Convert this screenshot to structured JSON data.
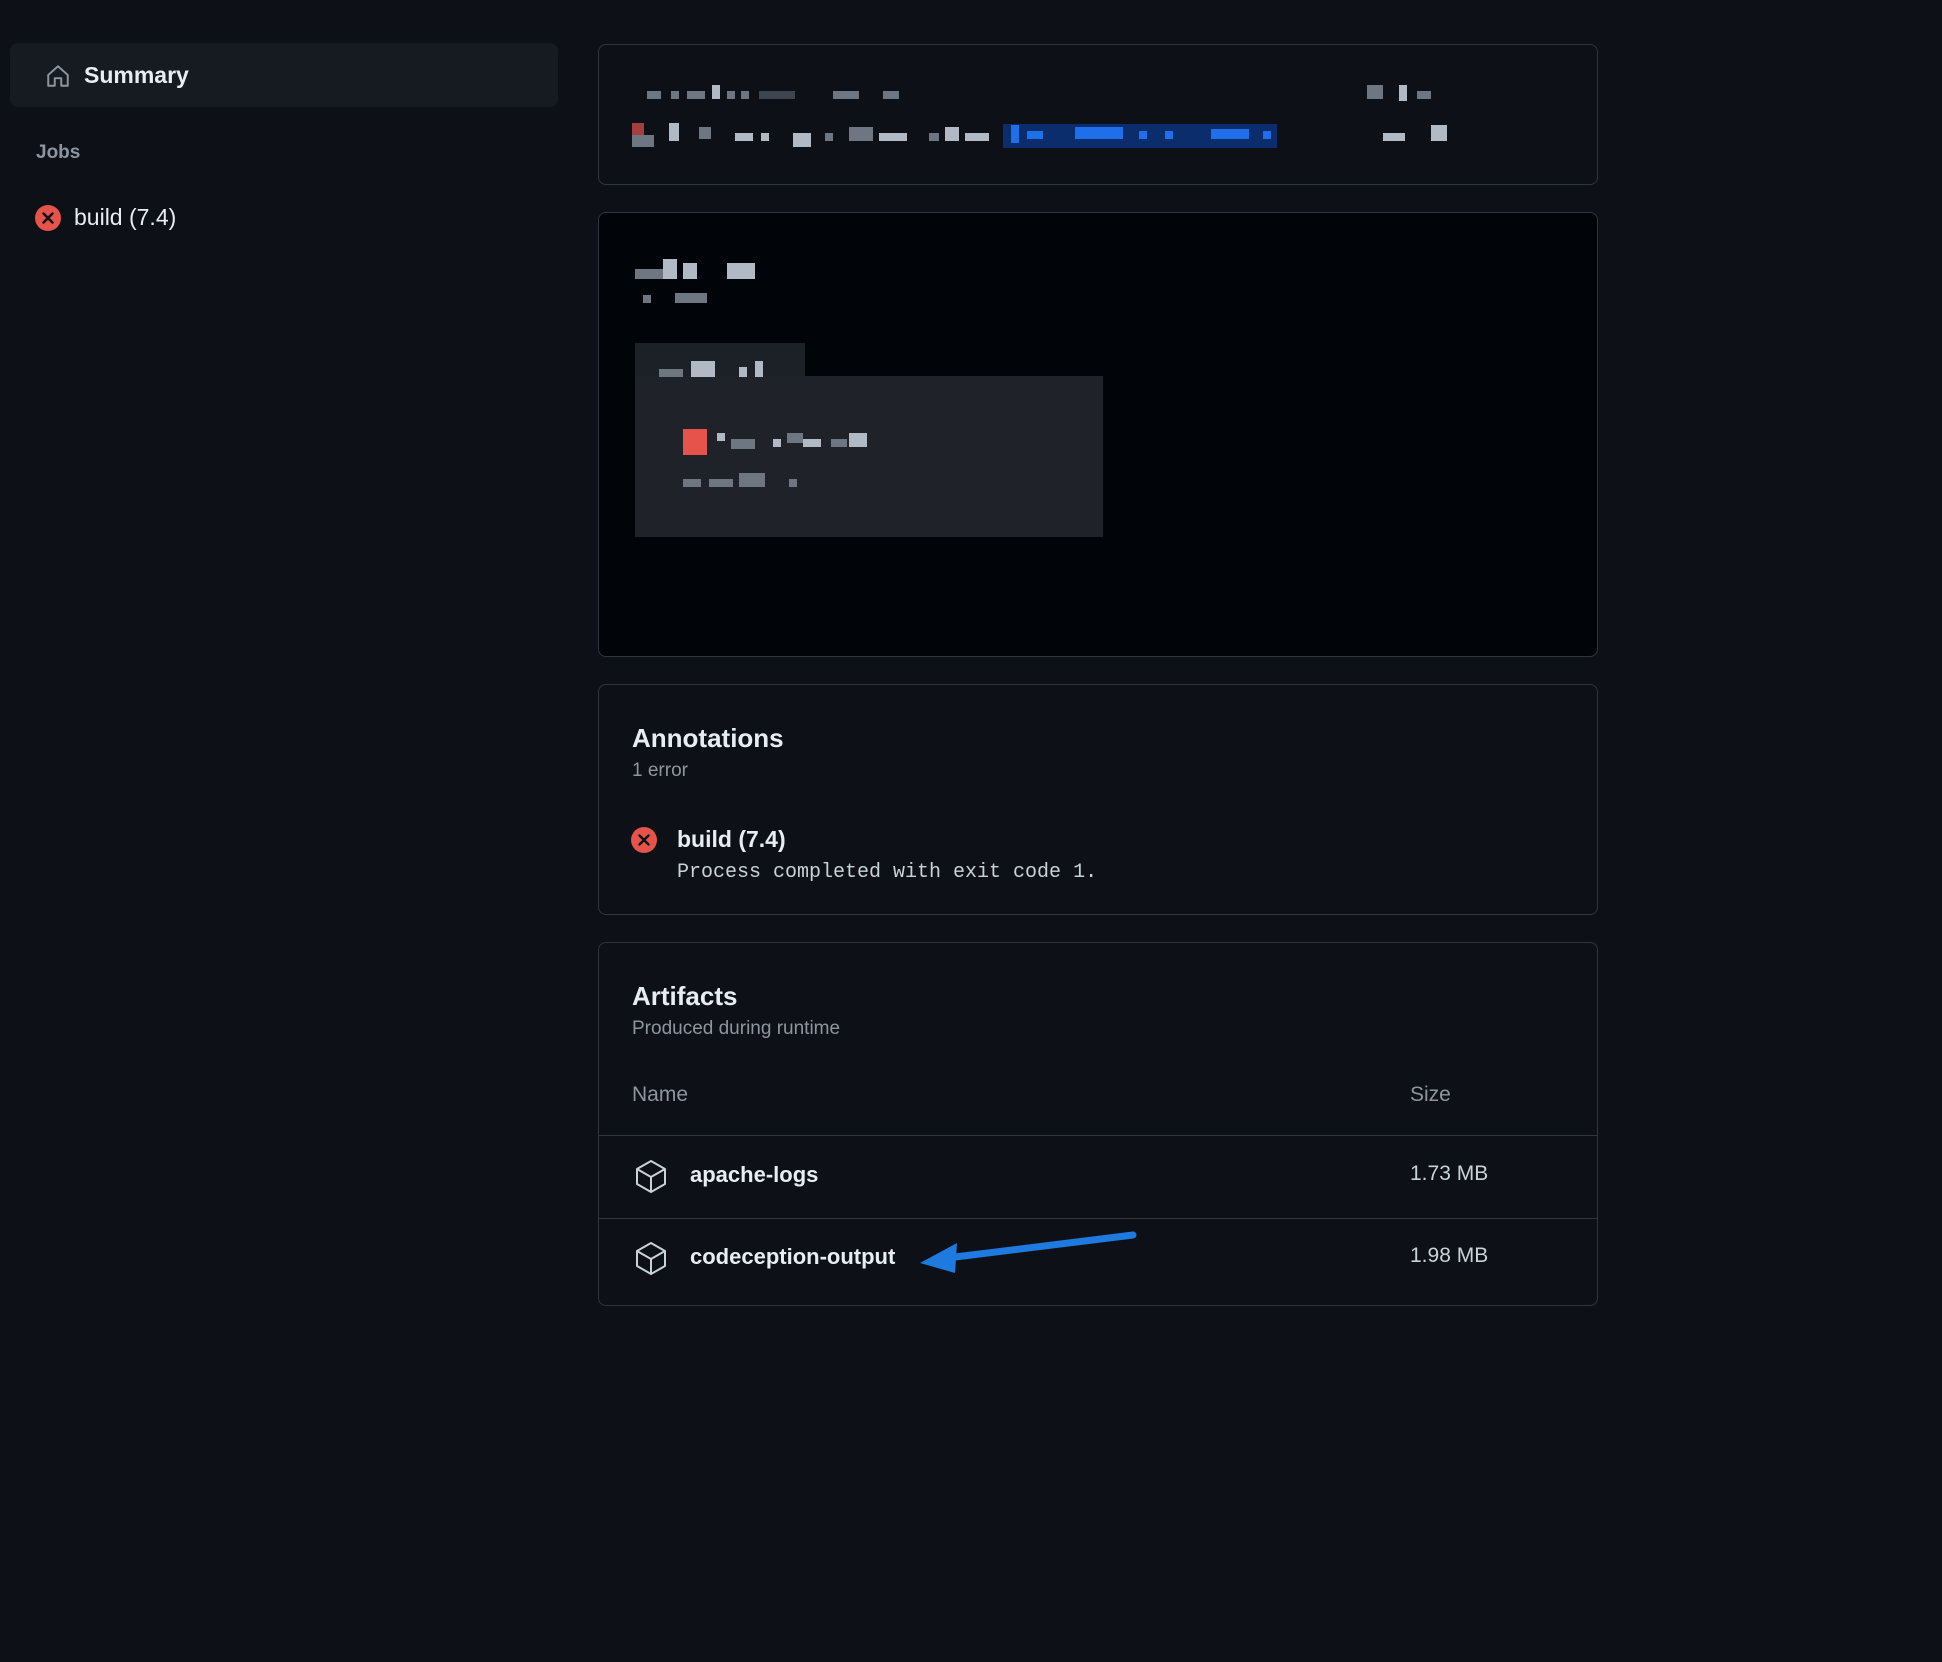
{
  "sidebar": {
    "summary_label": "Summary",
    "jobs_heading": "Jobs",
    "jobs": [
      {
        "label": "build (7.4)",
        "status": "failed"
      }
    ]
  },
  "annotations": {
    "title": "Annotations",
    "count_label": "1 error",
    "items": [
      {
        "title": "build (7.4)",
        "message": "Process completed with exit code 1.",
        "status": "error"
      }
    ]
  },
  "artifacts": {
    "title": "Artifacts",
    "subtitle": "Produced during runtime",
    "columns": {
      "name": "Name",
      "size": "Size"
    },
    "rows": [
      {
        "name": "apache-logs",
        "size": "1.73 MB",
        "icon": "package-icon"
      },
      {
        "name": "codeception-output",
        "size": "1.98 MB",
        "icon": "package-icon"
      }
    ]
  },
  "colors": {
    "background": "#0d1117",
    "card_border": "#30363d",
    "error": "#e5534b",
    "annotation_arrow": "#1f7ae0",
    "muted_text": "#8d96a0"
  }
}
